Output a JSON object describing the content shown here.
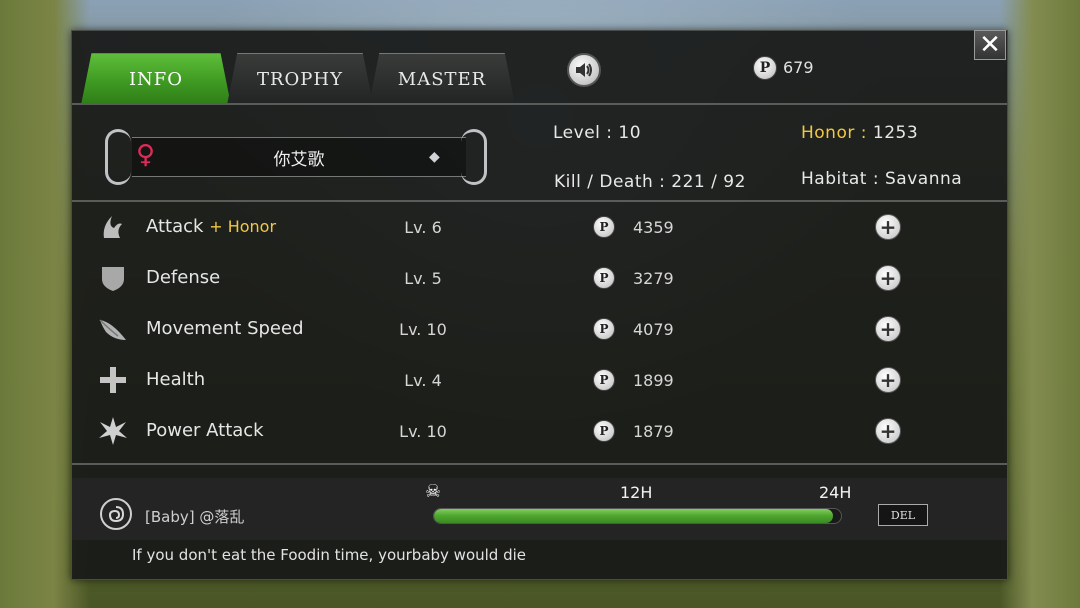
{
  "tabs": [
    {
      "label": "INFO",
      "active": true
    },
    {
      "label": "TROPHY",
      "active": false
    },
    {
      "label": "MASTER",
      "active": false
    }
  ],
  "top": {
    "points": "679",
    "coin_symbol": "P",
    "close_symbol": "✕",
    "sound_icon": "speaker-icon"
  },
  "profile": {
    "name": "你艾歌",
    "gender_symbol": "♀",
    "level_label": "Level :",
    "level_value": "10",
    "honor_label": "Honor :",
    "honor_value": "1253",
    "kill_death_label": "Kill / Death :",
    "kill_death_value": "221 / 92",
    "habitat_label": "Habitat :",
    "habitat_value": "Savanna"
  },
  "stats": [
    {
      "name": "Attack",
      "bonus": "+ Honor",
      "level": "Lv. 6",
      "cost": "4359",
      "icon": "claw-icon"
    },
    {
      "name": "Defense",
      "bonus": "",
      "level": "Lv. 5",
      "cost": "3279",
      "icon": "shield-icon"
    },
    {
      "name": "Movement Speed",
      "bonus": "",
      "level": "Lv. 10",
      "cost": "4079",
      "icon": "wing-icon"
    },
    {
      "name": "Health",
      "bonus": "",
      "level": "Lv. 4",
      "cost": "1899",
      "icon": "cross-icon"
    },
    {
      "name": "Power Attack",
      "bonus": "",
      "level": "Lv. 10",
      "cost": "1879",
      "icon": "burst-icon"
    }
  ],
  "baby": {
    "label": "[Baby] @落乱",
    "mark_12": "12H",
    "mark_24": "24H",
    "progress_fraction": 0.98,
    "del_label": "DEL",
    "notice": "If you don't eat the Foodin time, yourbaby would die"
  },
  "colors": {
    "active_tab": "#4aa82a",
    "gold": "#f0c844",
    "gender": "#e02a5a",
    "progress": "#5cb53a"
  }
}
